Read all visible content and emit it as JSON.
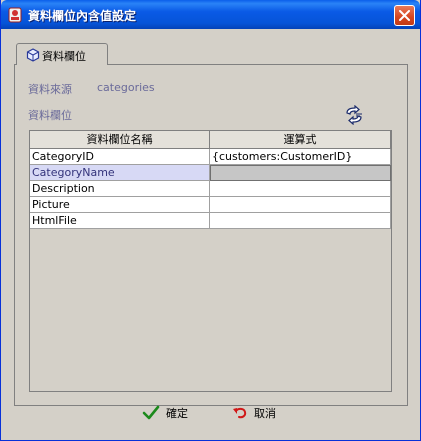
{
  "window": {
    "title": "資料欄位內含值設定",
    "accent": "#0a5ae6"
  },
  "tab": {
    "label": "資料欄位"
  },
  "source": {
    "label": "資料來源",
    "value": "categories"
  },
  "fields_label": "資料欄位",
  "table": {
    "columns": [
      "資料欄位名稱",
      "運算式"
    ],
    "rows": [
      [
        "CategoryID",
        "{customers:CustomerID}"
      ],
      [
        "CategoryName",
        ""
      ],
      [
        "Description",
        ""
      ],
      [
        "Picture",
        ""
      ],
      [
        "HtmlFile",
        ""
      ]
    ],
    "selected_row": 1
  },
  "buttons": {
    "ok": "確定",
    "cancel": "取消"
  },
  "icons": {
    "app": "app-icon",
    "close": "close-icon",
    "tab": "cube-icon",
    "swap": "swap-icon",
    "ok": "checkmark-icon",
    "cancel": "undo-arrow-icon"
  }
}
